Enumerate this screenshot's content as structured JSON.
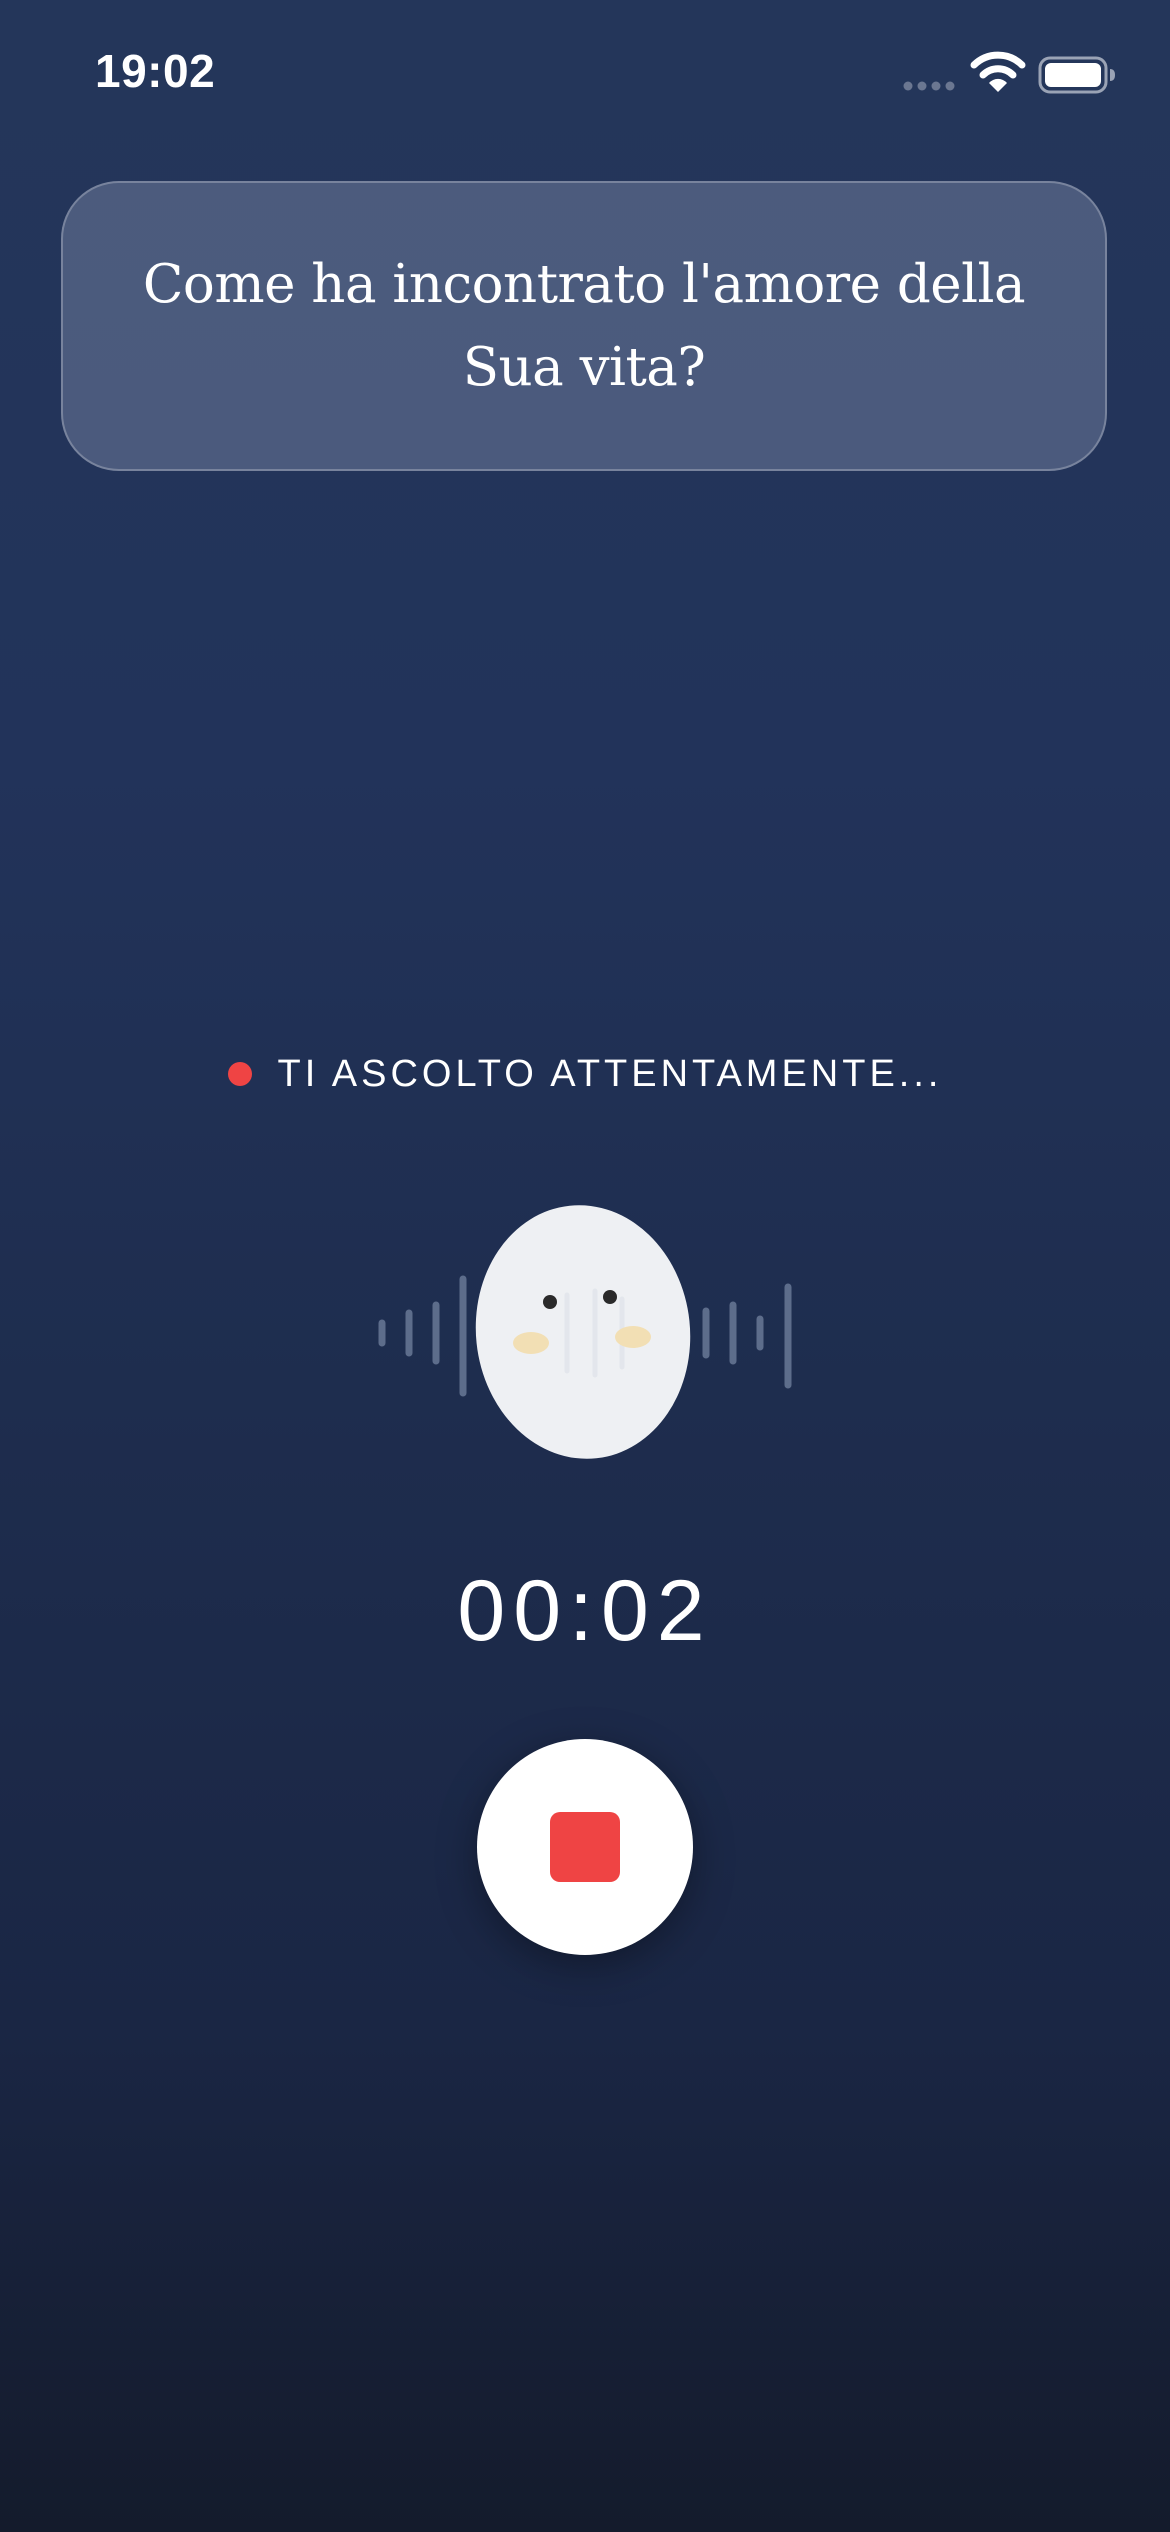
{
  "status_bar": {
    "time": "19:02"
  },
  "question": {
    "text": "Come ha incontrato l'amore della Sua vita?"
  },
  "recording": {
    "status_label": "TI ASCOLTO ATTENTAMENTE...",
    "elapsed": "00:02",
    "indicator_color": "#ef4444"
  },
  "controls": {
    "stop_icon": "stop-icon",
    "stop_color": "#ef4444"
  },
  "colors": {
    "background_top": "#24365a",
    "background_bottom": "#141b2c",
    "mascot_body": "#eef0f3",
    "mascot_cheeks": "#f2dfb4",
    "wave_bars": "#5d6d8b"
  }
}
